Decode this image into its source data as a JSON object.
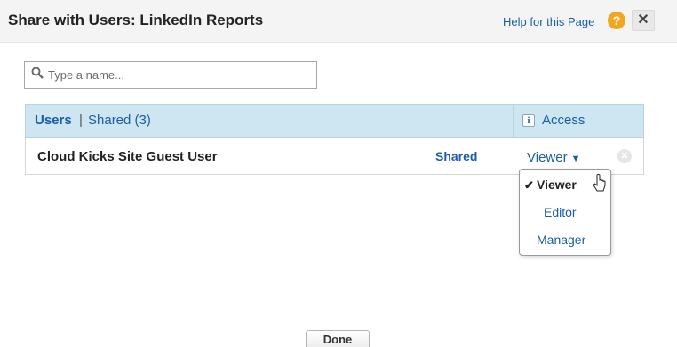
{
  "dialog": {
    "title": "Share with Users: LinkedIn Reports",
    "help_label": "Help for this Page",
    "help_icon": "?",
    "close_icon": "✕"
  },
  "search": {
    "placeholder": "Type a name...",
    "value": "",
    "icon": "search-icon"
  },
  "table": {
    "header": {
      "users_label": "Users",
      "separator": "|",
      "shared_label": "Shared (3)",
      "access_label": "Access",
      "info_icon": "i"
    },
    "rows": [
      {
        "name": "Cloud Kicks Site Guest User",
        "status": "Shared",
        "access": "Viewer",
        "caret": "▼"
      }
    ]
  },
  "access_menu": {
    "items": [
      {
        "label": "Viewer",
        "selected": true,
        "check": "✔"
      },
      {
        "label": "Editor",
        "selected": false
      },
      {
        "label": "Manager",
        "selected": false
      }
    ]
  },
  "footer": {
    "done_label": "Done"
  },
  "colors": {
    "link_blue": "#1a5ea6",
    "header_band": "#cde6f2",
    "help_orange": "#f2a720"
  }
}
